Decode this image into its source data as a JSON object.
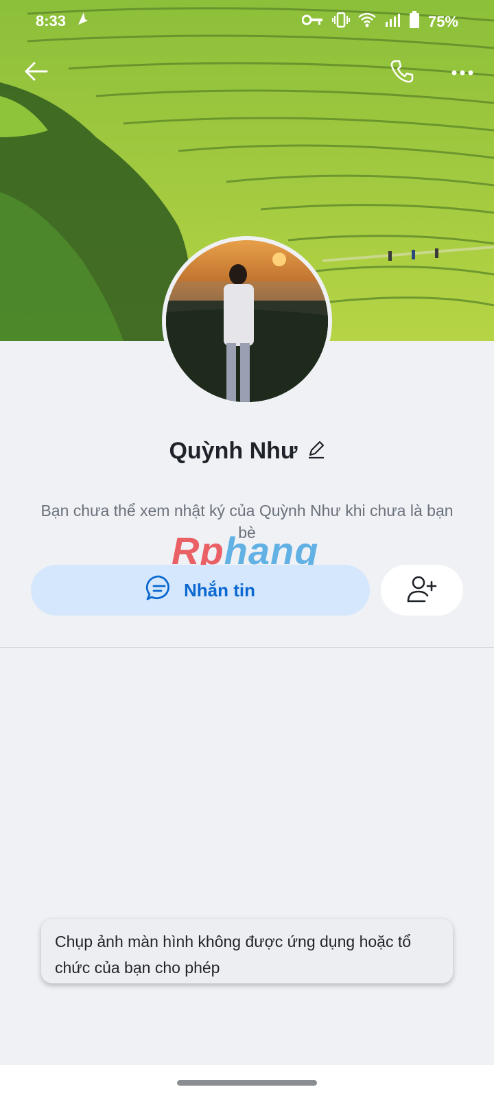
{
  "status_bar": {
    "time": "8:33",
    "battery": "75%",
    "icons": [
      "navigation-arrow-icon",
      "key-icon",
      "vibrate-icon",
      "wifi-icon",
      "signal-icon",
      "battery-icon"
    ]
  },
  "header": {
    "back_icon": "arrow-left-icon",
    "call_icon": "phone-icon",
    "more_icon": "more-horizontal-icon"
  },
  "profile": {
    "name": "Quỳnh Như",
    "edit_icon": "pencil-icon",
    "notice": "Bạn chưa thể xem nhật ký của Quỳnh Như khi chưa là bạn bè"
  },
  "watermark": {
    "part1": "Rp",
    "part2": "hang"
  },
  "actions": {
    "message_label": "Nhắn tin",
    "message_icon": "chat-bubble-icon",
    "add_friend_icon": "user-plus-icon"
  },
  "toast": {
    "text": "Chụp ảnh màn hình không được ứng dụng hoặc tổ chức của bạn cho phép"
  },
  "colors": {
    "accent": "#0a68d0",
    "button_bg": "#d4e7fc",
    "page_bg": "#eff1f5"
  }
}
